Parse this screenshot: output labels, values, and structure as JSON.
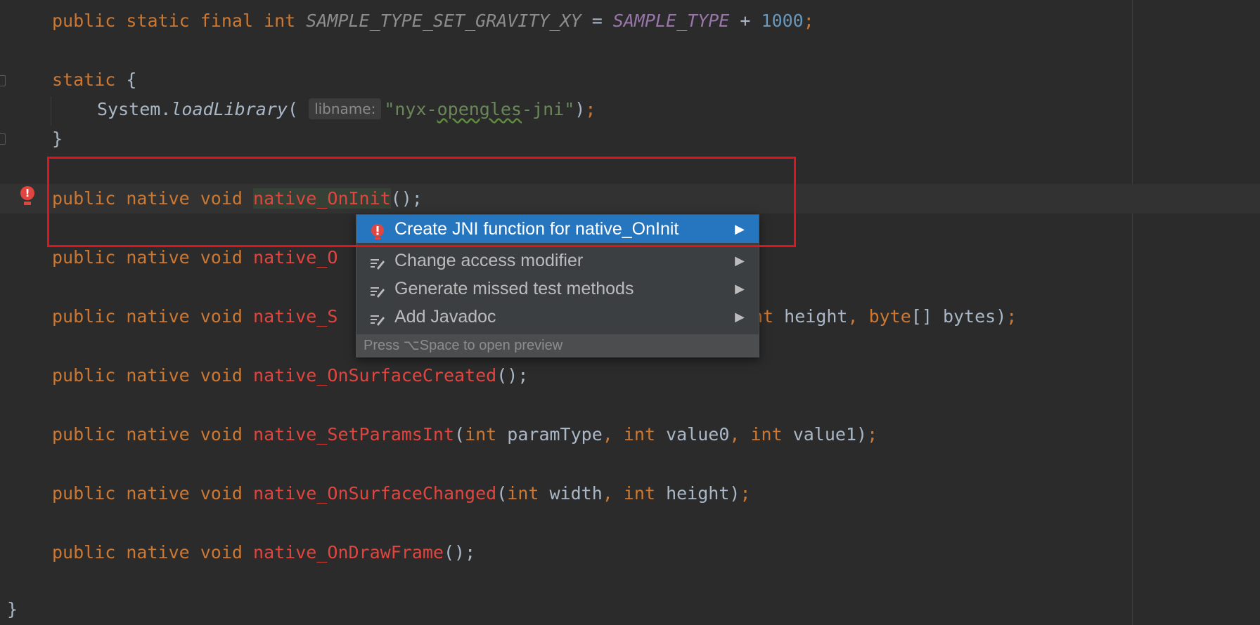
{
  "code": {
    "line1": {
      "kw1": "public",
      "kw2": "static",
      "kw3": "final",
      "kw4": "int",
      "name": "SAMPLE_TYPE_SET_GRAVITY_XY",
      "eq": " = ",
      "ref": "SAMPLE_TYPE",
      "plus": " + ",
      "num": "1000",
      "end": ";"
    },
    "static_block": {
      "kw": "static",
      "open": " {",
      "call_obj": "System.",
      "call_fn": "loadLibrary",
      "paren_open": "(",
      "hint": "libname:",
      "str_open": "\"nyx-",
      "str_squiggle": "opengles",
      "str_close": "-jni\"",
      "paren_close": ")",
      "semicolon": ";",
      "close": "}"
    },
    "native_line": {
      "kw1": "public",
      "kw2": "native",
      "kw3": "void"
    },
    "on_init": {
      "fn": "native_OnInit",
      "rest": "();"
    },
    "line_native_O": {
      "fn": "native_O"
    },
    "line_native_S": {
      "fn": "native_S",
      "tail_kw": "nt",
      "tail_name": " height",
      "comma": ", ",
      "tail_kw2": "byte",
      "tail_rest": "[] bytes)",
      "semicolon": ";"
    },
    "on_surface_created": {
      "fn": "native_OnSurfaceCreated",
      "rest": "();"
    },
    "set_params_int": {
      "fn": "native_SetParamsInt",
      "open": "(",
      "int": "int",
      "p1": " paramType",
      "comma": ", ",
      "p2": " value0",
      "p3": " value1",
      "close": ")",
      "semicolon": ";"
    },
    "on_surface_changed": {
      "fn": "native_OnSurfaceChanged",
      "open": "(",
      "int": "int",
      "p1": " width",
      "comma": ", ",
      "p2": " height",
      "close": ")",
      "semicolon": ";"
    },
    "on_draw_frame": {
      "fn": "native_OnDrawFrame",
      "rest": "();"
    },
    "class_close": "}"
  },
  "popup": {
    "items": [
      {
        "label": "Create JNI function for native_OnInit",
        "icon": "error-bulb-icon",
        "selected": true
      },
      {
        "label": "Change access modifier",
        "icon": "edit-intention-icon",
        "selected": false
      },
      {
        "label": "Generate missed test methods",
        "icon": "edit-intention-icon",
        "selected": false
      },
      {
        "label": "Add Javadoc",
        "icon": "edit-intention-icon",
        "selected": false
      }
    ],
    "arrow": "▶",
    "footer": "Press ⌥Space to open preview"
  },
  "colors": {
    "background": "#2b2b2b",
    "keyword": "#cc7832",
    "error_function": "#e0463f",
    "selection": "#2675bf",
    "highlight_box": "#e1141b"
  }
}
